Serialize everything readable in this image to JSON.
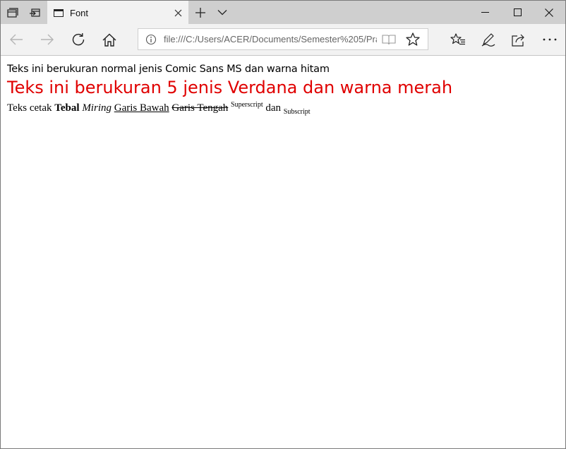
{
  "tab": {
    "title": "Font"
  },
  "address_bar": {
    "url": "file:///C:/Users/ACER/Documents/Semester%205/Pra"
  },
  "page": {
    "line1": "Teks ini berukuran normal jenis Comic Sans MS dan warna hitam",
    "line2": "Teks ini berukuran 5 jenis Verdana dan warna merah",
    "line3": {
      "prefix": "Teks cetak",
      "bold": "Tebal",
      "italic": "Miring",
      "underline": "Garis Bawah",
      "strike": "Garis Tengah",
      "superscript": "Superscript",
      "middle": "dan",
      "subscript": "Subscript"
    }
  },
  "colors": {
    "red_text": "#e00000",
    "tab_active": "#f2f2f2",
    "tabstrip": "#cfcfcf"
  },
  "icons": [
    "set-aside-tabs-icon",
    "restore-tabs-icon",
    "tab-page-icon",
    "close-icon",
    "new-tab-icon",
    "chevron-down-icon",
    "minimize-icon",
    "maximize-icon",
    "back-icon",
    "forward-icon",
    "refresh-icon",
    "home-icon",
    "info-icon",
    "reading-view-icon",
    "favorite-star-icon",
    "favorites-hub-icon",
    "pen-icon",
    "share-icon",
    "more-icon"
  ]
}
